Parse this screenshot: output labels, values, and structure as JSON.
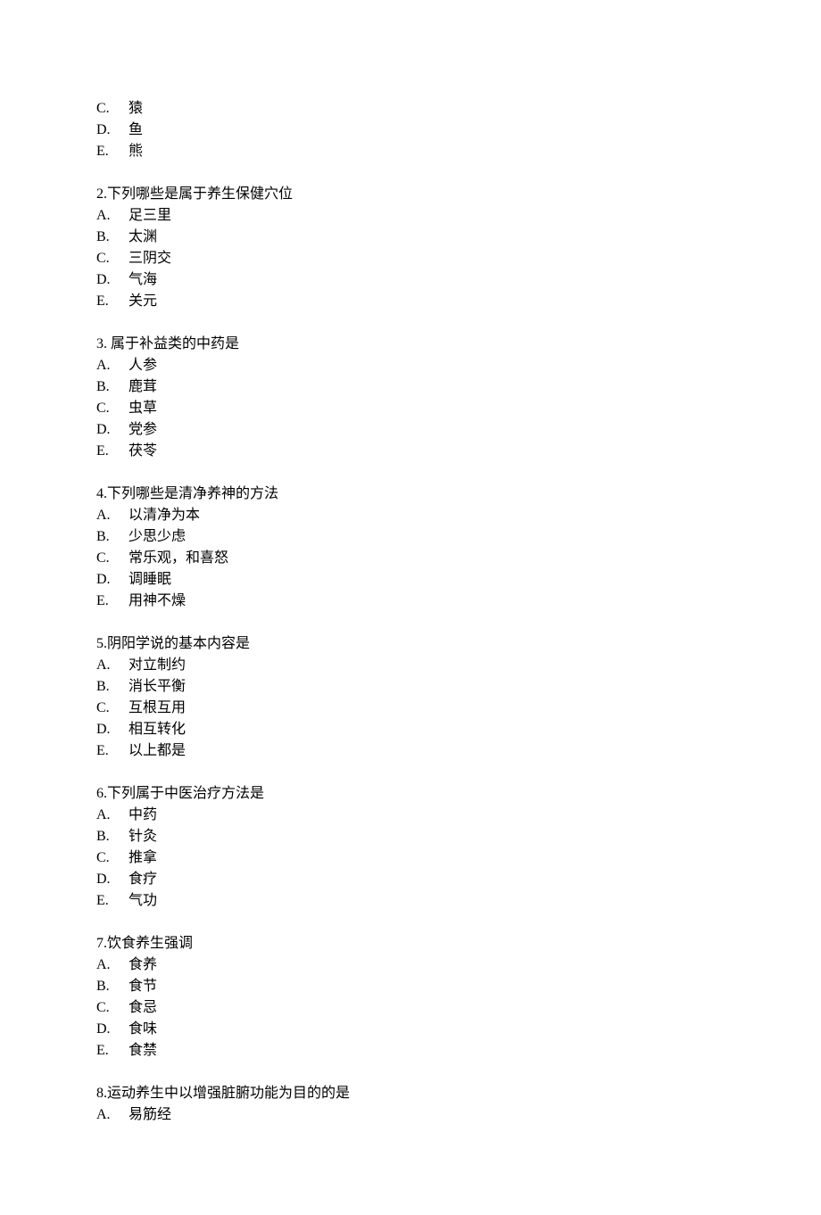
{
  "questions": [
    {
      "number": "",
      "stem": "",
      "options": [
        {
          "letter": "C.",
          "text": "猿"
        },
        {
          "letter": "D.",
          "text": "鱼"
        },
        {
          "letter": "E.",
          "text": "熊"
        }
      ]
    },
    {
      "number": "2.",
      "stem": "下列哪些是属于养生保健穴位",
      "options": [
        {
          "letter": "A.",
          "text": "足三里"
        },
        {
          "letter": "B.",
          "text": "太渊"
        },
        {
          "letter": "C.",
          "text": "三阴交"
        },
        {
          "letter": "D.",
          "text": "气海"
        },
        {
          "letter": "E.",
          "text": "关元"
        }
      ]
    },
    {
      "number": "3.",
      "stem": " 属于补益类的中药是",
      "options": [
        {
          "letter": "A.",
          "text": "人参"
        },
        {
          "letter": "B.",
          "text": "鹿茸"
        },
        {
          "letter": "C.",
          "text": "虫草"
        },
        {
          "letter": "D.",
          "text": "党参"
        },
        {
          "letter": "E.",
          "text": "茯苓"
        }
      ]
    },
    {
      "number": "4.",
      "stem": "下列哪些是清净养神的方法",
      "options": [
        {
          "letter": "A.",
          "text": "以清净为本"
        },
        {
          "letter": "B.",
          "text": "少思少虑"
        },
        {
          "letter": "C.",
          "text": "常乐观，和喜怒"
        },
        {
          "letter": "D.",
          "text": "调睡眠"
        },
        {
          "letter": "E.",
          "text": "用神不燥"
        }
      ]
    },
    {
      "number": "5.",
      "stem": "阴阳学说的基本内容是",
      "options": [
        {
          "letter": "A.",
          "text": "对立制约"
        },
        {
          "letter": "B.",
          "text": "消长平衡"
        },
        {
          "letter": "C.",
          "text": "互根互用"
        },
        {
          "letter": "D.",
          "text": "相互转化"
        },
        {
          "letter": "E.",
          "text": "以上都是"
        }
      ]
    },
    {
      "number": "6.",
      "stem": "下列属于中医治疗方法是",
      "options": [
        {
          "letter": "A.",
          "text": "中药"
        },
        {
          "letter": "B.",
          "text": "针灸"
        },
        {
          "letter": "C.",
          "text": "推拿"
        },
        {
          "letter": "D.",
          "text": "食疗"
        },
        {
          "letter": "E.",
          "text": "气功"
        }
      ]
    },
    {
      "number": "7.",
      "stem": "饮食养生强调",
      "options": [
        {
          "letter": "A.",
          "text": "食养"
        },
        {
          "letter": "B.",
          "text": "食节"
        },
        {
          "letter": "C.",
          "text": "食忌"
        },
        {
          "letter": "D.",
          "text": "食味"
        },
        {
          "letter": "E.",
          "text": "食禁"
        }
      ]
    },
    {
      "number": "8.",
      "stem": "运动养生中以增强脏腑功能为目的的是",
      "options": [
        {
          "letter": "A.",
          "text": "易筋经"
        }
      ]
    }
  ]
}
